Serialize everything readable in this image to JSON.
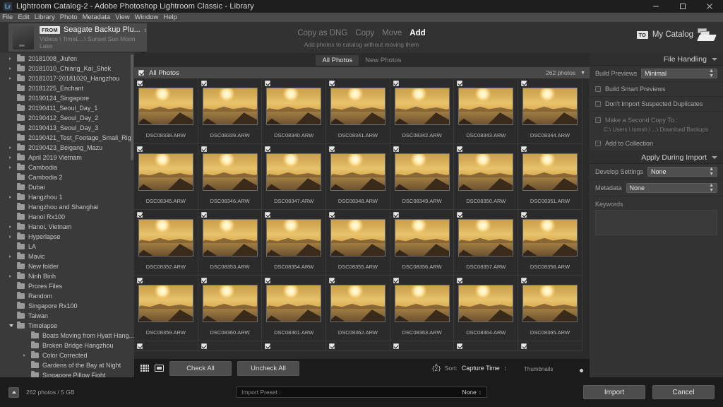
{
  "window": {
    "title": "Lightroom Catalog-2 - Adobe Photoshop Lightroom Classic - Library",
    "logo_text": "Lr",
    "minimize": "–",
    "maximize": "❐",
    "close": "×"
  },
  "menubar": {
    "items": [
      "File",
      "Edit",
      "Library",
      "Photo",
      "Metadata",
      "View",
      "Window",
      "Help"
    ]
  },
  "import_header": {
    "from_badge": "FROM",
    "source_name": "Seagate Backup Plu...",
    "source_dropdown_mark": "↕",
    "source_path": "Videos \\ TimeL...\\ Sunset Sun Moon Lake",
    "left_arrow": "→",
    "right_arrow": "→",
    "modes": [
      {
        "label": "Copy as DNG",
        "active": false
      },
      {
        "label": "Copy",
        "active": false
      },
      {
        "label": "Move",
        "active": false
      },
      {
        "label": "Add",
        "active": true
      }
    ],
    "mode_subtitle": "Add photos to catalog without moving them",
    "to_badge": "TO",
    "destination": "My Catalog"
  },
  "sidebar": {
    "folders": [
      {
        "name": "20181008_Jiufen",
        "level": 1,
        "twisty": "closed"
      },
      {
        "name": "20181010_Chiang_Kai_Shek",
        "level": 1,
        "twisty": "closed"
      },
      {
        "name": "20181017-20181020_Hangzhou",
        "level": 1,
        "twisty": "closed"
      },
      {
        "name": "20181225_Enchant",
        "level": 1,
        "twisty": "none"
      },
      {
        "name": "20190124_Singapore",
        "level": 1,
        "twisty": "none"
      },
      {
        "name": "20190411_Seoul_Day_1",
        "level": 1,
        "twisty": "none"
      },
      {
        "name": "20190412_Seoul_Day_2",
        "level": 1,
        "twisty": "none"
      },
      {
        "name": "20190413_Seoul_Day_3",
        "level": 1,
        "twisty": "none"
      },
      {
        "name": "20190421_Test_Footage_Small_Rig",
        "level": 1,
        "twisty": "none"
      },
      {
        "name": "20190423_Beigang_Mazu",
        "level": 1,
        "twisty": "closed"
      },
      {
        "name": "April 2019 Vietnam",
        "level": 1,
        "twisty": "closed"
      },
      {
        "name": "Cambodia",
        "level": 1,
        "twisty": "closed"
      },
      {
        "name": "Cambodia 2",
        "level": 1,
        "twisty": "none"
      },
      {
        "name": "Dubai",
        "level": 1,
        "twisty": "none"
      },
      {
        "name": "Hangzhou 1",
        "level": 1,
        "twisty": "closed"
      },
      {
        "name": "Hangzhou and Shanghai",
        "level": 1,
        "twisty": "none"
      },
      {
        "name": "Hanoi Rx100",
        "level": 1,
        "twisty": "none"
      },
      {
        "name": "Hanoi, Vietnam",
        "level": 1,
        "twisty": "closed"
      },
      {
        "name": "Hyperlapse",
        "level": 1,
        "twisty": "closed"
      },
      {
        "name": "LA",
        "level": 1,
        "twisty": "none"
      },
      {
        "name": "Mavic",
        "level": 1,
        "twisty": "closed"
      },
      {
        "name": "New folder",
        "level": 1,
        "twisty": "none"
      },
      {
        "name": "Ninh Binh",
        "level": 1,
        "twisty": "closed"
      },
      {
        "name": "Prores Files",
        "level": 1,
        "twisty": "none"
      },
      {
        "name": "Random",
        "level": 1,
        "twisty": "none"
      },
      {
        "name": "Singapore Rx100",
        "level": 1,
        "twisty": "none"
      },
      {
        "name": "Taiwan",
        "level": 1,
        "twisty": "none"
      },
      {
        "name": "Timelapse",
        "level": 1,
        "twisty": "open"
      },
      {
        "name": "Boats Moving from Hyatt Hang...",
        "level": 2,
        "twisty": "none"
      },
      {
        "name": "Broken Bridge Hangzhou",
        "level": 2,
        "twisty": "none"
      },
      {
        "name": "Color Corrected",
        "level": 2,
        "twisty": "closed"
      },
      {
        "name": "Gardens of the Bay at Night",
        "level": 2,
        "twisty": "none"
      },
      {
        "name": "Singapore Pillow Fight",
        "level": 2,
        "twisty": "none"
      }
    ]
  },
  "center": {
    "tabs": [
      {
        "label": "All Photos",
        "active": true
      },
      {
        "label": "New Photos",
        "active": false
      }
    ],
    "source_row_label": "All Photos",
    "photo_count": "262 photos",
    "photos": [
      "DSC08338.ARW",
      "DSC08339.ARW",
      "DSC08340.ARW",
      "DSC08341.ARW",
      "DSC08342.ARW",
      "DSC08343.ARW",
      "DSC08344.ARW",
      "DSC08345.ARW",
      "DSC08346.ARW",
      "DSC08347.ARW",
      "DSC08348.ARW",
      "DSC08349.ARW",
      "DSC08350.ARW",
      "DSC08351.ARW",
      "DSC08352.ARW",
      "DSC08353.ARW",
      "DSC08354.ARW",
      "DSC08355.ARW",
      "DSC08356.ARW",
      "DSC08357.ARW",
      "DSC08358.ARW",
      "DSC08359.ARW",
      "DSC08360.ARW",
      "DSC08361.ARW",
      "DSC08362.ARW",
      "DSC08363.ARW",
      "DSC08364.ARW",
      "DSC08365.ARW"
    ],
    "toolbar": {
      "check_all": "Check All",
      "uncheck_all": "Uncheck All",
      "sort_label": "Sort:",
      "sort_value": "Capture Time",
      "sort_mark": "↕",
      "thumbnails_label": "Thumbnails",
      "az_top": "A",
      "az_bottom": "Z"
    }
  },
  "right_panel": {
    "file_handling": {
      "title": "File Handling",
      "build_previews_label": "Build Previews",
      "build_previews_value": "Minimal",
      "build_smart_previews": "Build Smart Previews",
      "dont_import_duplicates": "Don't Import Suspected Duplicates",
      "second_copy_label": "Make a Second Copy To :",
      "second_copy_path": "C:\\ Users \\ tomsh \\ ...\\ Download Backups",
      "add_to_collection": "Add to Collection"
    },
    "apply_during_import": {
      "title": "Apply During Import",
      "develop_settings_label": "Develop Settings",
      "develop_settings_value": "None",
      "metadata_label": "Metadata",
      "metadata_value": "None",
      "keywords_label": "Keywords"
    }
  },
  "bottom": {
    "photos_size": "262 photos / 5 GB",
    "import_preset_label": "Import Preset :",
    "import_preset_value": "None",
    "import_preset_mark": "↕",
    "import_button": "Import",
    "cancel_button": "Cancel"
  },
  "colors": {
    "app_bg": "#2c2c2c",
    "panel_bg": "#333333",
    "sidebar_bg": "#3a3a3a",
    "accent_text": "#ffffff",
    "thumb_sky": "#e8c46d"
  }
}
